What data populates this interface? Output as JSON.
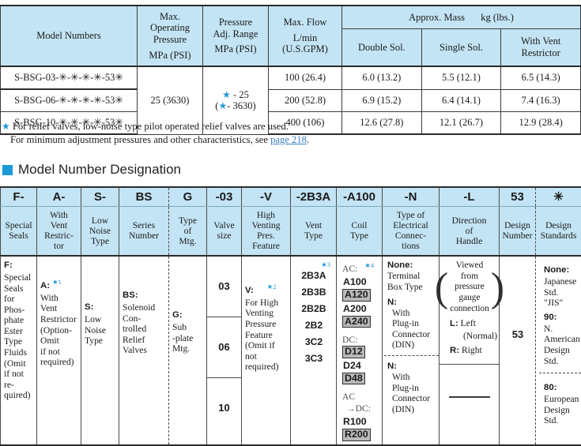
{
  "spec_table": {
    "headers": {
      "model_numbers": "Model Numbers",
      "max_operating_pressure": "Max.\nOperating\nPressure",
      "max_operating_pressure_unit": "MPa (PSI)",
      "pressure_adj_range": "Pressure\nAdj. Range",
      "pressure_adj_range_unit": "MPa (PSI)",
      "max_flow": "Max. Flow",
      "max_flow_unit1": "L/min",
      "max_flow_unit2": "(U.S.GPM)",
      "approx_mass": "Approx. Mass",
      "approx_mass_unit": "kg (lbs.)",
      "double_sol": "Double Sol.",
      "single_sol": "Single Sol.",
      "with_vent_restrictor": "With Vent\nRestrictor"
    },
    "rows": [
      {
        "model": "S-BSG-03-✳-✳-✳-✳-53✳",
        "max_flow": "100 (26.4)",
        "double_sol": "6.0 (13.2)",
        "single_sol": "5.5 (12.1)",
        "with_vent": "6.5 (14.3)"
      },
      {
        "model": "S-BSG-06-✳-✳-✳-✳-53✳",
        "max_flow": "200 (52.8)",
        "double_sol": "6.9 (15.2)",
        "single_sol": "6.4 (14.1)",
        "with_vent": "7.4 (16.3)"
      },
      {
        "model": "S-BSG-10-✳-✳-✳-✳-53✳",
        "max_flow": "400 (106)",
        "double_sol": "12.6 (27.8)",
        "single_sol": "12.1 (26.7)",
        "with_vent": "12.9 (28.4)"
      }
    ],
    "merged": {
      "max_operating_pressure_value": "25 (3630)",
      "pressure_adj_range_line1": "- 25",
      "pressure_adj_range_line2_pre": "(",
      "pressure_adj_range_line2_post": "- 3630)"
    }
  },
  "footnote": {
    "line1": "For relief valves, low-noise type pilot operated relief valves are used.",
    "line2_pre": "For minimum adjustment pressures and other characteristics, see ",
    "line2_link": "page 218",
    "line2_post": "."
  },
  "section": {
    "title": "Model Number Designation"
  },
  "designation": {
    "columns": [
      {
        "code": "F-",
        "desc": "Special\nSeals",
        "body_bold": "F:",
        "body_text": "Special Seals for Phos- phate Ester Type Fluids (Omit if not re- quired)"
      },
      {
        "code": "A-",
        "desc": "With\nVent\nRestric-\ntor",
        "body_bold": "A:",
        "footnote_mark": "★1",
        "body_text": "With Vent Restrictor (Option- Omit if not required)"
      },
      {
        "code": "S-",
        "desc": "Low\nNoise\nType",
        "body_bold": "S:",
        "body_text": "Low Noise Type"
      },
      {
        "code": "BS",
        "desc": "Series\nNumber",
        "body_bold": "BS:",
        "body_text": "Solenoid Con- trolled Relief Valves"
      },
      {
        "code": "G",
        "desc": "Type\nof\nMtg.",
        "body_bold": "G:",
        "body_text": "Sub -plate Mtg."
      },
      {
        "code": "-03",
        "desc": "Valve\nsize",
        "sizes": [
          "03",
          "06",
          "10"
        ]
      },
      {
        "code": "-V",
        "desc": "High\nVenting\nPres.\nFeature",
        "body_bold": "V:",
        "footnote_mark": "★2",
        "body_text": "For High Venting Pressure Feature (Omit if not required)"
      },
      {
        "code": "-2B3A",
        "desc": "Vent\nType",
        "footnote_mark": "★3",
        "vent_types": [
          "2B3A",
          "2B3B",
          "2B2B",
          "2B2",
          "3C2",
          "3C3"
        ]
      },
      {
        "code": "-A100",
        "desc": "Coil\nType",
        "footnote_mark": "★4",
        "groups": [
          {
            "label": "AC:",
            "values": [
              {
                "text": "A100",
                "boxed": false
              },
              {
                "text": "A120",
                "boxed": true
              },
              {
                "text": "A200",
                "boxed": false
              },
              {
                "text": "A240",
                "boxed": true
              }
            ]
          },
          {
            "label": "DC:",
            "values": [
              {
                "text": "D12",
                "boxed": true
              },
              {
                "text": "D24",
                "boxed": false
              },
              {
                "text": "D48",
                "boxed": true
              }
            ]
          },
          {
            "label": "AC\n→DC:",
            "values": [
              {
                "text": "R100",
                "boxed": false
              },
              {
                "text": "R200",
                "boxed": true
              }
            ]
          }
        ]
      },
      {
        "code": "-N",
        "desc": "Type of\nElectrical\nConnec-\ntions",
        "entries": [
          {
            "bold": "None:",
            "text": "Terminal Box Type",
            "indent": false
          },
          {
            "bold": "N:",
            "text": "With Plug-in Connector (DIN)",
            "indent": true
          }
        ],
        "entries_below": [
          {
            "bold": "N:",
            "text": "With Plug-in Connector (DIN)",
            "indent": true
          }
        ]
      },
      {
        "code": "-L",
        "desc": "Direction\nof\nHandle",
        "note": "Viewed\nfrom\npressure\ngauge\nconnection",
        "options": [
          {
            "bold": "L:",
            "text": "Left"
          },
          {
            "bold": "",
            "text": "(Normal)"
          },
          {
            "bold": "R:",
            "text": "Right"
          }
        ],
        "below_dash": "—"
      },
      {
        "code": "53",
        "desc": "Design\nNumber",
        "body_text": "53"
      },
      {
        "code": "✳",
        "desc": "Design Standards",
        "entries": [
          {
            "bold": "None:",
            "text": "Japanese Std. \"JIS\""
          },
          {
            "bold": "90:",
            "text": "N. American Design Std."
          }
        ],
        "entries_below": [
          {
            "bold": "80:",
            "text": "European Design Std."
          }
        ]
      }
    ]
  },
  "colors": {
    "header_blue": "#c3e4f4",
    "accent_blue": "#1c9ad6",
    "star_blue": "#2596d8",
    "link_blue": "#3a7fc1",
    "boxed_gray": "#b9b9b9",
    "border_dark": "#2b2b2b"
  }
}
